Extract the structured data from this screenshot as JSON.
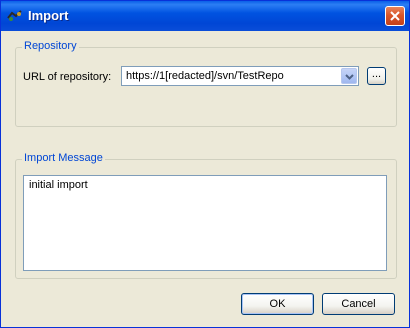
{
  "window": {
    "title": "Import",
    "icon": "import-app-icon",
    "close_icon": "close-icon"
  },
  "repository": {
    "group_title": "Repository",
    "url_label": "URL of repository:",
    "url_value": "https://1[redacted]/svn/TestRepo",
    "browse_label": "..."
  },
  "message": {
    "group_title": "Import Message",
    "text": "initial import"
  },
  "buttons": {
    "ok_label": "OK",
    "cancel_label": "Cancel"
  },
  "colors": {
    "titlebar": "#0046d5",
    "dialog_bg": "#ece9d8",
    "group_title": "#0046d5",
    "close_button": "#d9562a"
  }
}
